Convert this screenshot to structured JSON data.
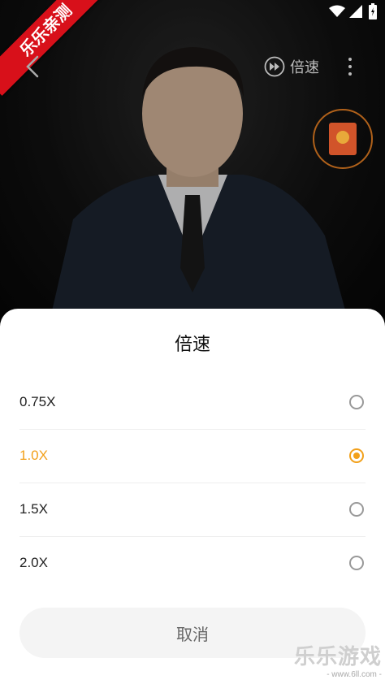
{
  "corner_badge": "乐乐亲测",
  "top_bar": {
    "speed_label": "倍速"
  },
  "sheet": {
    "title": "倍速",
    "options": [
      {
        "label": "0.75X",
        "selected": false
      },
      {
        "label": "1.0X",
        "selected": true
      },
      {
        "label": "1.5X",
        "selected": false
      },
      {
        "label": "2.0X",
        "selected": false
      }
    ],
    "cancel_label": "取消"
  },
  "watermark": {
    "title": "乐乐游戏",
    "url": "- www.6ll.com -"
  },
  "colors": {
    "accent": "#f2a01a",
    "ribbon": "#d8101a"
  }
}
